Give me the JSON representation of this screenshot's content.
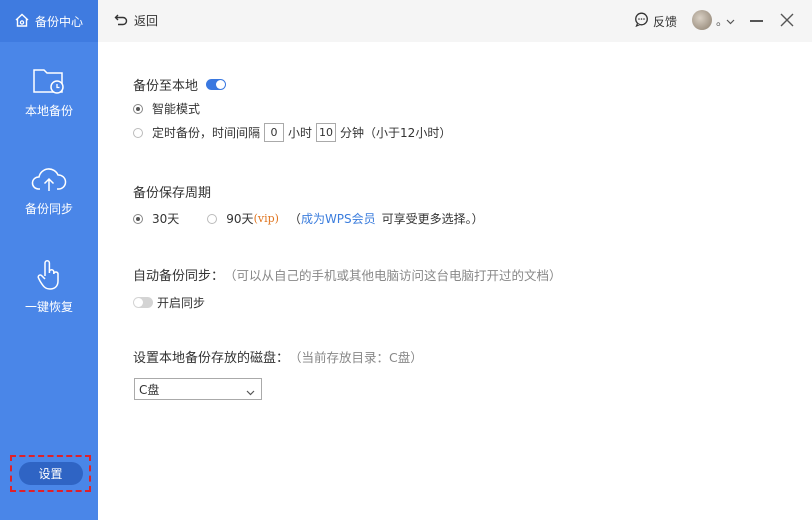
{
  "sidebar": {
    "brand": "备份中心",
    "items": [
      {
        "label": "本地备份",
        "icon": "folder-clock-icon"
      },
      {
        "label": "备份同步",
        "icon": "cloud-upload-icon"
      },
      {
        "label": "一键恢复",
        "icon": "hand-pointer-icon"
      }
    ],
    "settings_label": "设置"
  },
  "topbar": {
    "back_label": "返回",
    "feedback_label": "反馈",
    "avatar_suffix": "。"
  },
  "local_backup": {
    "title": "备份至本地",
    "enabled": true,
    "smart_mode_label": "智能模式",
    "timed_label": "定时备份，时间间隔",
    "hours_value": "0",
    "hours_unit": "小时",
    "minutes_value": "10",
    "minutes_unit": "分钟",
    "note": "（小于12小时）"
  },
  "retention": {
    "title": "备份保存周期",
    "option_30": "30天",
    "option_90": "90天",
    "vip_tag": "(vip)",
    "paren_open": "（",
    "link": "成为WPS会员",
    "link_suffix": "可享受更多选择。）"
  },
  "sync": {
    "title": "自动备份同步：",
    "description": "（可以从自己的手机或其他电脑访问这台电脑打开过的文档）",
    "toggle_label": "开启同步"
  },
  "disk": {
    "title": "设置本地备份存放的磁盘：",
    "current": "（当前存放目录：C盘）",
    "selected": "C盘"
  },
  "colors": {
    "sidebar": "#4a86e8",
    "accent": "#3a78e0",
    "highlight": "#e0202a"
  }
}
